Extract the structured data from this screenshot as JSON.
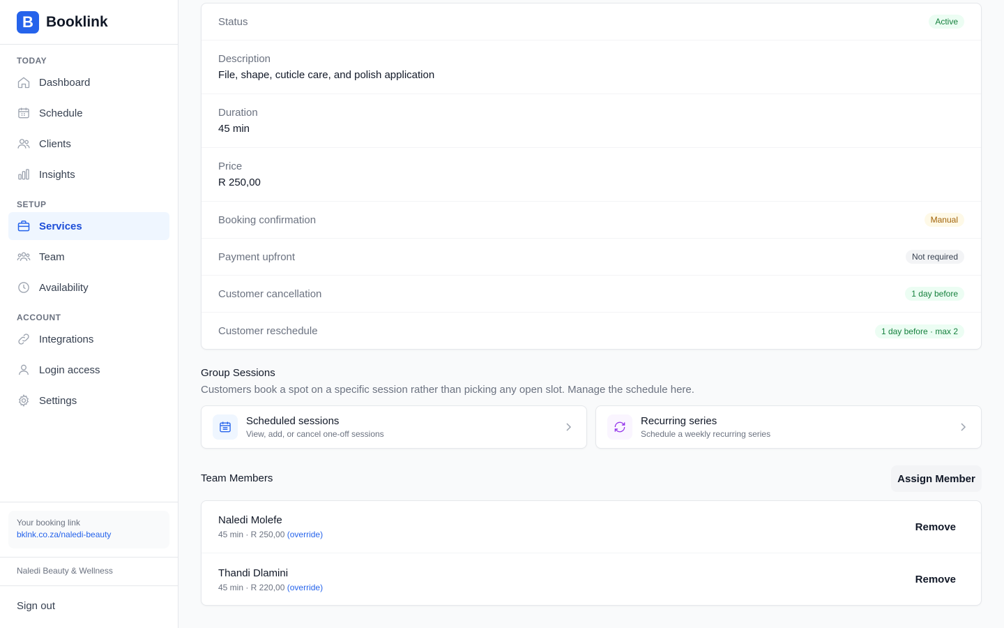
{
  "brand": {
    "logo_letter": "B",
    "name": "Booklink"
  },
  "sidebar": {
    "sections": [
      {
        "label": "TODAY",
        "items": [
          {
            "label": "Dashboard",
            "icon": "home-icon"
          },
          {
            "label": "Schedule",
            "icon": "calendar-icon"
          },
          {
            "label": "Clients",
            "icon": "users-icon"
          },
          {
            "label": "Insights",
            "icon": "bar-chart-icon"
          }
        ]
      },
      {
        "label": "SETUP",
        "items": [
          {
            "label": "Services",
            "icon": "briefcase-icon",
            "active": true
          },
          {
            "label": "Team",
            "icon": "team-icon"
          },
          {
            "label": "Availability",
            "icon": "clock-icon"
          }
        ]
      },
      {
        "label": "ACCOUNT",
        "items": [
          {
            "label": "Integrations",
            "icon": "link-icon"
          },
          {
            "label": "Login access",
            "icon": "user-icon"
          },
          {
            "label": "Settings",
            "icon": "gear-icon"
          }
        ]
      }
    ],
    "booking_label": "Your booking link",
    "booking_link": "bklnk.co.za/naledi-beauty",
    "business_name": "Naledi Beauty & Wellness",
    "sign_out": "Sign out"
  },
  "details": {
    "status_label": "Status",
    "status_value": "Active",
    "description_label": "Description",
    "description_value": "File, shape, cuticle care, and polish application",
    "duration_label": "Duration",
    "duration_value": "45 min",
    "price_label": "Price",
    "price_value": "R 250,00",
    "confirmation_label": "Booking confirmation",
    "confirmation_value": "Manual",
    "payment_label": "Payment upfront",
    "payment_value": "Not required",
    "cancellation_label": "Customer cancellation",
    "cancellation_value": "1 day before",
    "reschedule_label": "Customer reschedule",
    "reschedule_value": "1 day before · max 2"
  },
  "group_sessions": {
    "title": "Group Sessions",
    "description": "Customers book a spot on a specific session rather than picking any open slot. Manage the schedule here.",
    "scheduled": {
      "title": "Scheduled sessions",
      "subtitle": "View, add, or cancel one-off sessions"
    },
    "recurring": {
      "title": "Recurring series",
      "subtitle": "Schedule a weekly recurring series"
    }
  },
  "team": {
    "title": "Team Members",
    "assign_label": "Assign Member",
    "members": [
      {
        "name": "Naledi Molefe",
        "meta": "45 min · R 250,00",
        "override": "(override)",
        "remove": "Remove"
      },
      {
        "name": "Thandi Dlamini",
        "meta": "45 min · R 220,00",
        "override": "(override)",
        "remove": "Remove"
      }
    ]
  },
  "colors": {
    "accent": "#2563eb",
    "active_bg": "#eff6ff",
    "success": "#15803d",
    "warning": "#a16207"
  }
}
